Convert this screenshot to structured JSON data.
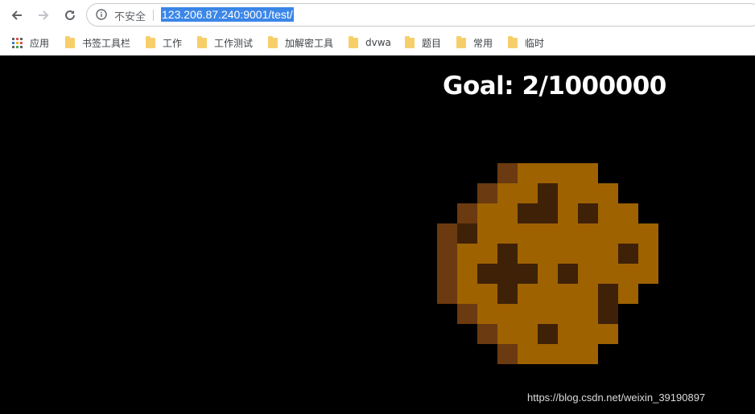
{
  "browser": {
    "security_text": "不安全",
    "url": "123.206.87.240:9001/test/",
    "bookmarks": [
      {
        "label": "应用",
        "icon": "apps-grid-icon"
      },
      {
        "label": "书签工具栏",
        "icon": "folder-icon"
      },
      {
        "label": "工作",
        "icon": "folder-icon"
      },
      {
        "label": "工作测试",
        "icon": "folder-icon"
      },
      {
        "label": "加解密工具",
        "icon": "folder-icon"
      },
      {
        "label": "dvwa",
        "icon": "folder-icon"
      },
      {
        "label": "题目",
        "icon": "folder-icon"
      },
      {
        "label": "常用",
        "icon": "folder-icon"
      },
      {
        "label": "临时",
        "icon": "folder-icon"
      }
    ]
  },
  "game": {
    "goal_text": "Goal: 2/1000000",
    "cookie_icon": "cookie-icon",
    "colors": {
      "background": "#000000",
      "cookie_base": "#9e6200",
      "cookie_shadow": "#6b3a10",
      "chocolate_chip": "#3f2108"
    }
  },
  "watermark": "https://blog.csdn.net/weixin_39190897"
}
